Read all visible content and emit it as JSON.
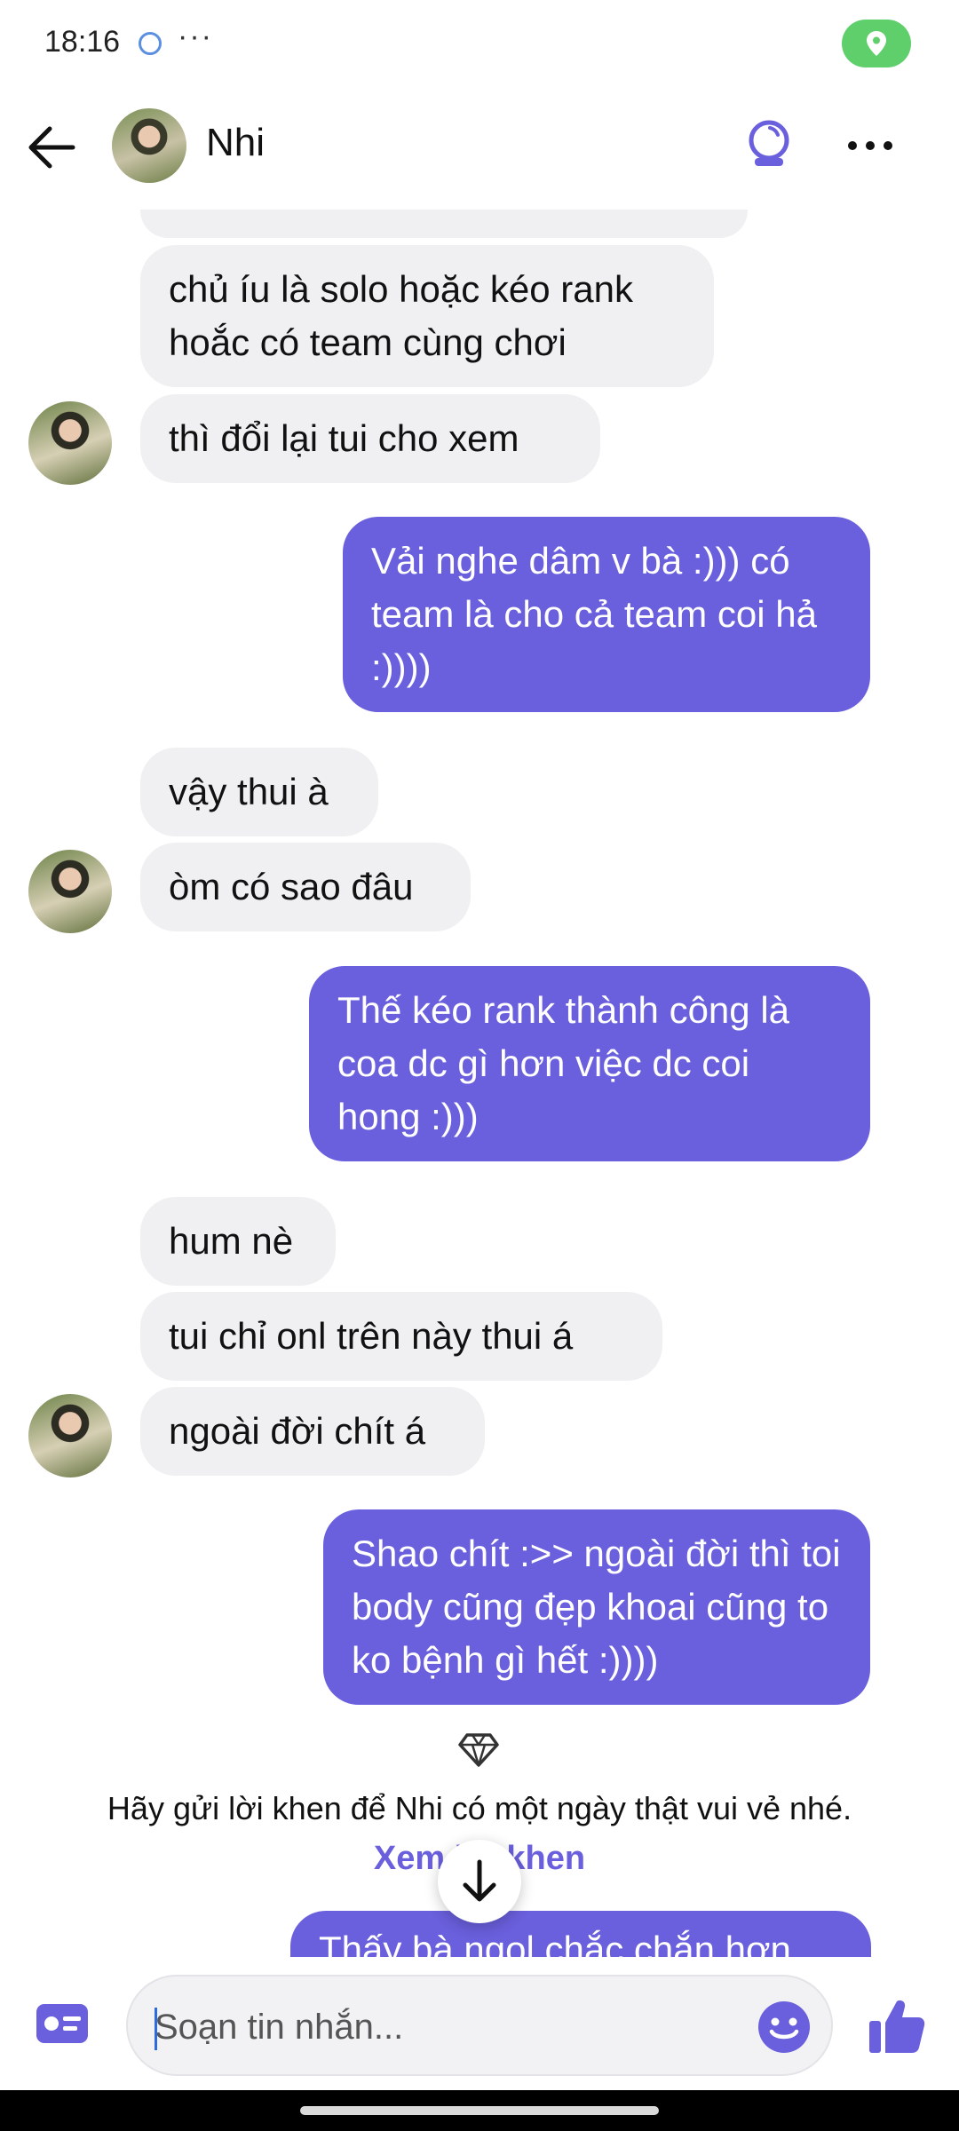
{
  "status_bar": {
    "time": "18:16",
    "more": "···"
  },
  "header": {
    "contact_name": "Nhi"
  },
  "messages": [
    {
      "side": "in",
      "text": "chủ íu là solo hoặc kéo rank hoắc có team cùng chơi"
    },
    {
      "side": "in",
      "text": "thì đổi lại tui cho xem"
    },
    {
      "side": "out",
      "text": "Vải nghe dâm v bà :))) có team là cho cả team coi hả :))))"
    },
    {
      "side": "in",
      "text": "vậy thui à"
    },
    {
      "side": "in",
      "text": "òm có sao đâu"
    },
    {
      "side": "out",
      "text": "Thế kéo rank thành công là coa dc gì hơn việc dc coi hong :)))"
    },
    {
      "side": "in",
      "text": "hum nè"
    },
    {
      "side": "in",
      "text": "tui chỉ onl trên này thui á"
    },
    {
      "side": "in",
      "text": "ngoài đời chít á"
    },
    {
      "side": "out",
      "text": "Shao chít :>> ngoài đời thì toi body cũng đẹp khoai cũng to ko bệnh gì hết :))))"
    }
  ],
  "suggestion": {
    "text": "Hãy gửi lời khen để Nhi có một ngày thật vui vẻ nhé.",
    "link": "Xem lời khen"
  },
  "partial_message": "Thấy bà ngol chắc chắn hơn",
  "composer": {
    "placeholder": "Soạn tin nhắn..."
  },
  "colors": {
    "accent": "#6a5fdc",
    "incoming_bubble": "#f0f0f3",
    "status_location": "#5fcf6c"
  }
}
